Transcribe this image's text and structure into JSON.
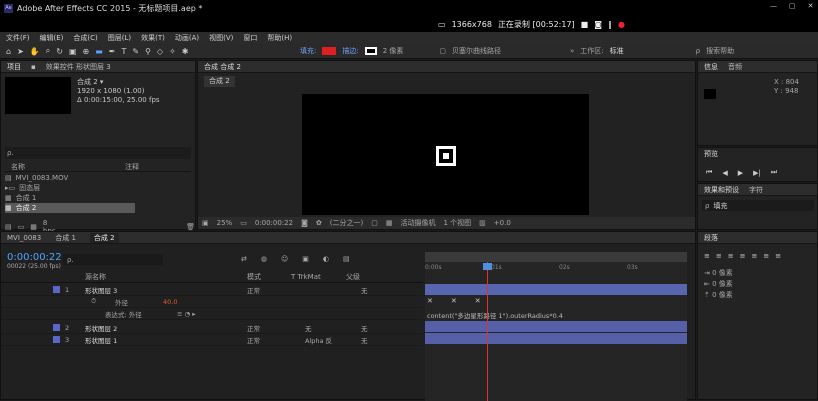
{
  "app": {
    "title": "Adobe After Effects CC 2015 - 无标题项目.aep *",
    "resolution": "1366x768",
    "recording": "正在录制 [00:52:17]"
  },
  "menu": [
    "文件(F)",
    "编辑(E)",
    "合成(C)",
    "图层(L)",
    "效果(T)",
    "动画(A)",
    "视图(V)",
    "窗口",
    "帮助(H)"
  ],
  "toolbar": {
    "fill": "填充:",
    "stroke": "描边:",
    "stroke_px": "2 像素",
    "bezier": "贝塞尔曲线路径",
    "workspace_label": "工作区:",
    "workspace": "标准",
    "search": "搜索帮助",
    "fill_color": "#e02020"
  },
  "project": {
    "tab1": "项目",
    "tab2": "效果控件 形状图层 3",
    "comp_name": "合成 2 ▾",
    "comp_size": "1920 x 1080 (1.00)",
    "comp_time": "Δ 0:00:15:00, 25.00 fps",
    "search_icon": "ρ.",
    "col_name": "名称",
    "col_note": "注释",
    "items": [
      {
        "name": "MVI_0083.MOV",
        "sel": false
      },
      {
        "name": "固态层",
        "sel": false
      },
      {
        "name": "合成 1",
        "sel": false
      },
      {
        "name": "合成 2",
        "sel": true
      }
    ],
    "bpc": "8 bpc"
  },
  "viewer": {
    "tab": "合成 合成 2",
    "subtab": "合成 2",
    "zoom": "25%",
    "timecode": "0:00:00:22",
    "quality": "(二分之一)",
    "camera": "活动摄像机",
    "views": "1 个视图",
    "exposure": "+0.0"
  },
  "info": {
    "tab1": "信息",
    "tab2": "音频",
    "x": "X : 804",
    "y": "Y : 948"
  },
  "preview": {
    "tab": "预览"
  },
  "effects": {
    "tab": "效果和预设",
    "tab2": "字符",
    "search": "填充"
  },
  "paragraph": {
    "tab": "段落",
    "r1": "0 像素",
    "r2": "0 像素",
    "r3": "0 像素"
  },
  "timeline": {
    "tabs": [
      "MVI_0083",
      "合成 1",
      "合成 2"
    ],
    "time": "0:00:00:22",
    "fps": "00022 (25.00 fps)",
    "col_src": "源名称",
    "col_mode": "模式",
    "col_trk": "T TrkMat",
    "col_parent": "父级",
    "layers": [
      {
        "num": "1",
        "name": "形状图层 3",
        "mode": "正常",
        "trk": "",
        "parent": "无"
      },
      {
        "num": "",
        "name": "外径",
        "value": "40.0",
        "mode": "",
        "trk": "",
        "parent": ""
      },
      {
        "num": "",
        "name": "表达式: 外径",
        "mode": "",
        "trk": "",
        "parent": ""
      },
      {
        "num": "2",
        "name": "形状图层 2",
        "mode": "正常",
        "trk": "无",
        "parent": "无"
      },
      {
        "num": "3",
        "name": "形状图层 1",
        "mode": "正常",
        "trk": "Alpha 反",
        "parent": "无"
      }
    ],
    "ticks": [
      "0:00s",
      "01s",
      "02s",
      "03s"
    ],
    "expression": "content(\"多边星形路径 1\").outerRadius*0.4"
  }
}
